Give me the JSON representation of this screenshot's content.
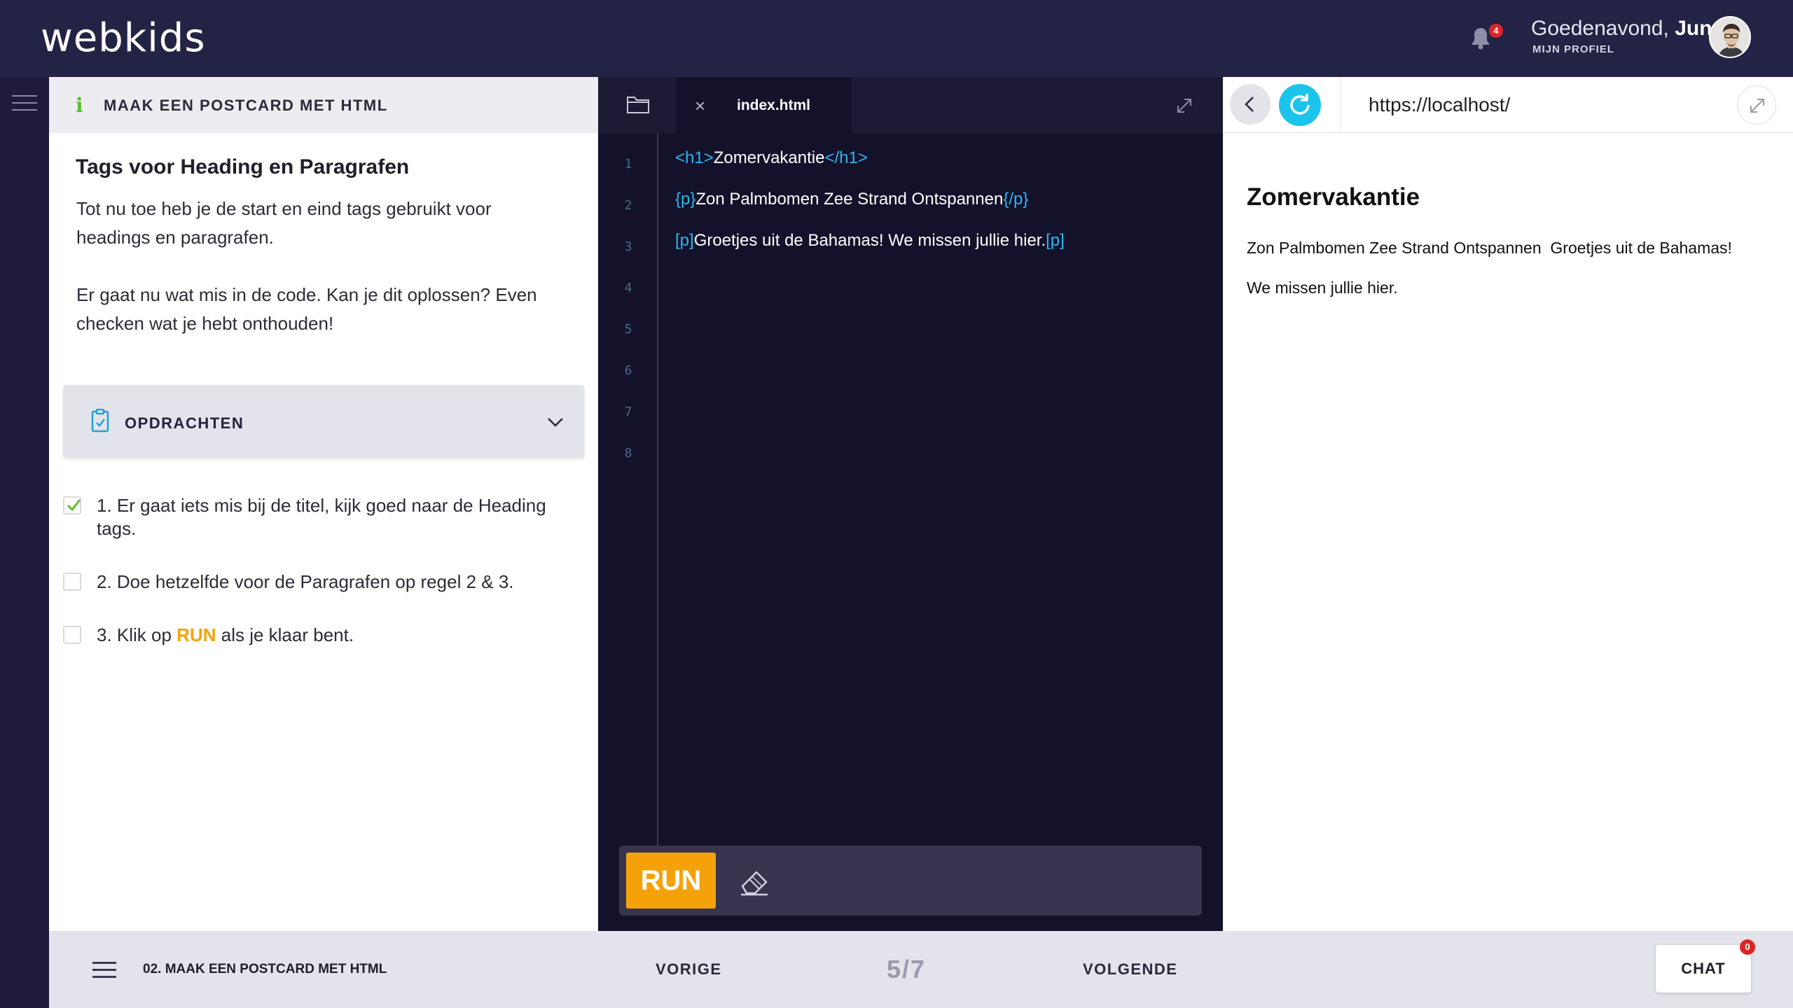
{
  "app": {
    "logo": "webkids"
  },
  "header": {
    "notification_count": "4",
    "greeting": "Goedenavond,",
    "user_name": "Jun",
    "profile_link": "MIJN PROFIEL"
  },
  "instructions": {
    "panel_title": "MAAK EEN POSTCARD MET HTML",
    "heading": "Tags voor Heading en Paragrafen",
    "paragraph_1": "Tot nu toe heb je de start en eind tags gebruikt voor headings en paragrafen.",
    "paragraph_2": "Er gaat nu wat mis in de code. Kan je dit oplossen? Even checken wat je hebt onthouden!",
    "accordion_title": "OPDRACHTEN",
    "tasks": [
      {
        "text": "1. Er gaat iets mis bij de titel, kijk goed naar de Heading tags.",
        "checked": true
      },
      {
        "text": "2. Doe hetzelfde voor de Paragrafen op regel 2 & 3.",
        "checked": false
      },
      {
        "text_before": "3. Klik op ",
        "highlight": "RUN",
        "text_after": " als je klaar bent.",
        "checked": false
      }
    ]
  },
  "editor": {
    "tab_label": "index.html",
    "line_numbers": [
      "1",
      "2",
      "3",
      "4",
      "5",
      "6",
      "7",
      "8"
    ],
    "lines": [
      {
        "open": "<h1>",
        "content": "Zomervakantie",
        "close": "</h1>"
      },
      {
        "open": "{p}",
        "content": "Zon Palmbomen Zee Strand Ontspannen",
        "close": "{/p}"
      },
      {
        "open": "[p]",
        "content": "Groetjes uit de Bahamas! We missen jullie hier.",
        "close": "[p]"
      }
    ],
    "run_label": "RUN",
    "tag_color": "#2ab6f2"
  },
  "preview": {
    "url": "https://localhost/",
    "heading": "Zomervakantie",
    "line_1": "Zon Palmbomen Zee Strand Ontspannen  Groetjes uit de Bahamas!",
    "line_2": "We missen jullie hier."
  },
  "footer": {
    "lesson": "02. MAAK EEN POSTCARD MET HTML",
    "prev_label": "VORIGE",
    "progress": "5/7",
    "next_label": "VOLGENDE",
    "chat_label": "CHAT",
    "chat_count": "0"
  },
  "colors": {
    "accent_orange": "#f5a20a",
    "accent_cyan": "#1cc4ec",
    "navy": "#232345",
    "check_green": "#5bbf2a"
  }
}
